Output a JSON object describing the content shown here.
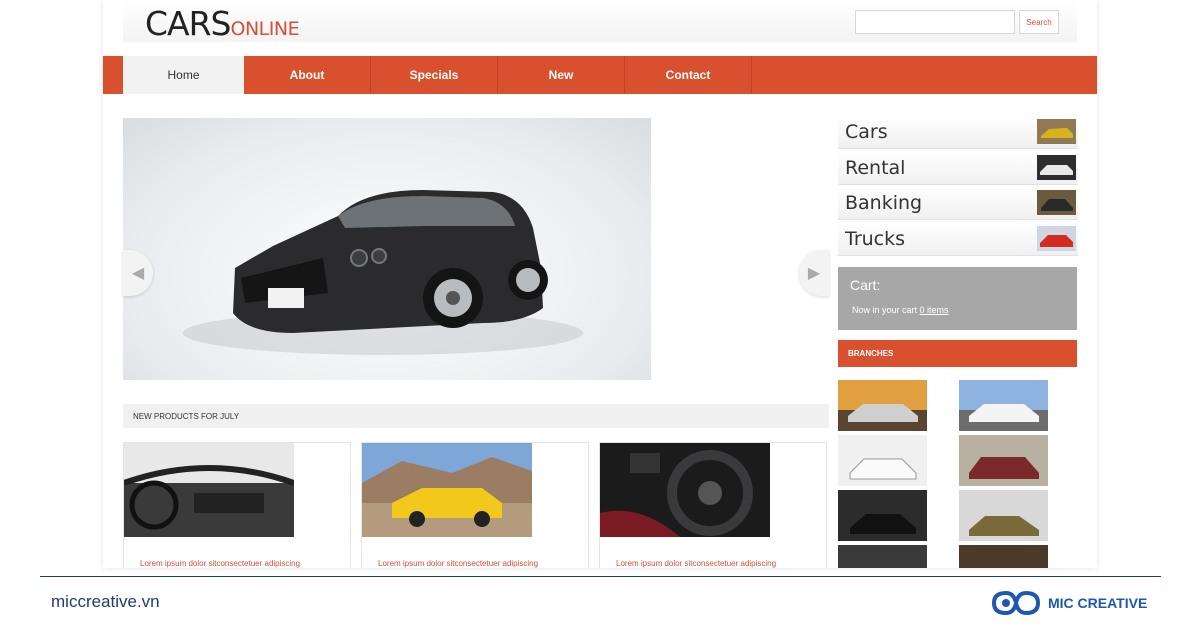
{
  "header": {
    "logo_main": "CARS",
    "logo_sub": "ONLINE",
    "search_button": "Search",
    "search_placeholder": ""
  },
  "nav": {
    "items": [
      {
        "label": "Home",
        "active": true
      },
      {
        "label": "About",
        "active": false
      },
      {
        "label": "Specials",
        "active": false
      },
      {
        "label": "New",
        "active": false
      },
      {
        "label": "Contact",
        "active": false
      }
    ]
  },
  "slider": {
    "prev_icon": "chevron-left-icon",
    "next_icon": "chevron-right-icon",
    "prev_glyph": "◀",
    "next_glyph": "▶"
  },
  "products": {
    "header": "NEW PRODUCTS FOR JULY",
    "items": [
      {
        "caption": "Lorem ipsum dolor sitconsectetuer adipiscing"
      },
      {
        "caption": "Lorem ipsum dolor sitconsectetuer adipiscing"
      },
      {
        "caption": "Lorem ipsum dolor sitconsectetuer adipiscing"
      }
    ]
  },
  "sidebar": {
    "items": [
      {
        "label": "Cars"
      },
      {
        "label": "Rental"
      },
      {
        "label": "Banking"
      },
      {
        "label": "Trucks"
      }
    ]
  },
  "cart": {
    "title": "Cart:",
    "text": "Now in your cart",
    "link": "0 items"
  },
  "branches": {
    "title": "BRANCHES"
  },
  "footer": {
    "site": "miccreative.vn",
    "brand": "MIC CREATIVE"
  },
  "colors": {
    "accent": "#d9502f",
    "brand_blue": "#1e57b0",
    "cart_gray": "#a7a7a7"
  }
}
